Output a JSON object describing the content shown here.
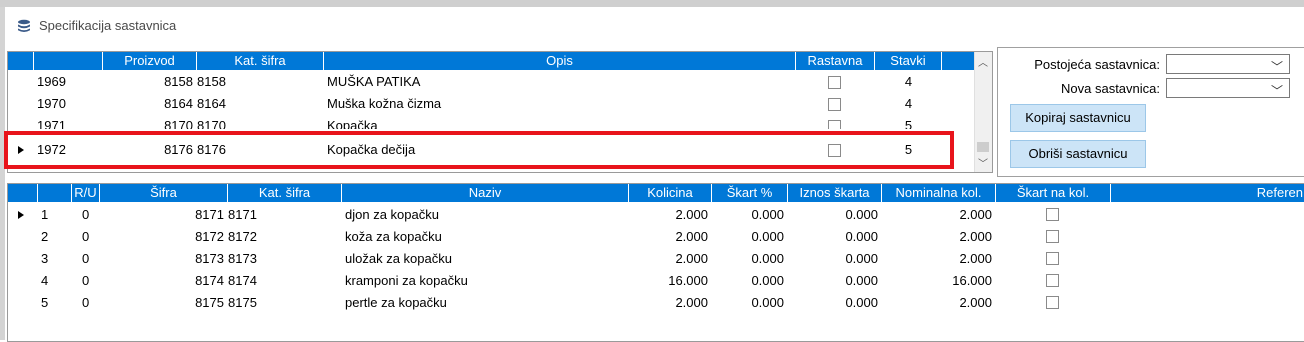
{
  "window": {
    "title": "Specifikacija sastavnica",
    "icon": "database-icon"
  },
  "top_grid": {
    "columns": [
      "",
      "",
      "Proizvod",
      "Kat. šifra",
      "Opis",
      "Rastavna",
      "Stavki"
    ],
    "rows": [
      {
        "id": "1969",
        "proizvod": "8158",
        "kat_sifra": "8158",
        "opis": "MUŠKA PATIKA",
        "rastavna": false,
        "stavki": "4",
        "current": false
      },
      {
        "id": "1970",
        "proizvod": "8164",
        "kat_sifra": "8164",
        "opis": "Muška kožna čizma",
        "rastavna": false,
        "stavki": "4",
        "current": false
      },
      {
        "id": "1971",
        "proizvod": "8170",
        "kat_sifra": "8170",
        "opis": "Kopačka",
        "rastavna": false,
        "stavki": "5",
        "current": false
      },
      {
        "id": "1972",
        "proizvod": "8176",
        "kat_sifra": "8176",
        "opis": "Kopačka dečija",
        "rastavna": false,
        "stavki": "5",
        "current": true
      }
    ]
  },
  "side_panel": {
    "existing_label": "Postojeća sastavnica:",
    "existing_value": "",
    "new_label": "Nova sastavnica:",
    "new_value": "",
    "copy_button": "Kopiraj sastavnicu",
    "delete_button": "Obriši sastavnicu"
  },
  "bottom_grid": {
    "columns": [
      "",
      "",
      "R/U",
      "Šifra",
      "Kat. šifra",
      "Naziv",
      "Kolicina",
      "Škart %",
      "Iznos škarta",
      "Nominalna kol.",
      "Škart na kol.",
      "Referen"
    ],
    "rows": [
      {
        "n": "1",
        "ru": "0",
        "sifra": "8171",
        "kat_sifra": "8171",
        "naziv": "djon za kopačku",
        "kolicina": "2.000",
        "skart_pct": "0.000",
        "iznos": "0.000",
        "nominalna": "2.000",
        "skart_na_kol": false,
        "current": true
      },
      {
        "n": "2",
        "ru": "0",
        "sifra": "8172",
        "kat_sifra": "8172",
        "naziv": "koža za kopačku",
        "kolicina": "2.000",
        "skart_pct": "0.000",
        "iznos": "0.000",
        "nominalna": "2.000",
        "skart_na_kol": false,
        "current": false
      },
      {
        "n": "3",
        "ru": "0",
        "sifra": "8173",
        "kat_sifra": "8173",
        "naziv": "uložak za kopačku",
        "kolicina": "2.000",
        "skart_pct": "0.000",
        "iznos": "0.000",
        "nominalna": "2.000",
        "skart_na_kol": false,
        "current": false
      },
      {
        "n": "4",
        "ru": "0",
        "sifra": "8174",
        "kat_sifra": "8174",
        "naziv": "kramponi za kopačku",
        "kolicina": "16.000",
        "skart_pct": "0.000",
        "iznos": "0.000",
        "nominalna": "16.000",
        "skart_na_kol": false,
        "current": false
      },
      {
        "n": "5",
        "ru": "0",
        "sifra": "8175",
        "kat_sifra": "8175",
        "naziv": "pertle za kopačku",
        "kolicina": "2.000",
        "skart_pct": "0.000",
        "iznos": "0.000",
        "nominalna": "2.000",
        "skart_na_kol": false,
        "current": false
      }
    ]
  },
  "colors": {
    "header_bg": "#0078d7",
    "highlight_border": "#e8141b",
    "button_bg": "#cce4f7"
  }
}
